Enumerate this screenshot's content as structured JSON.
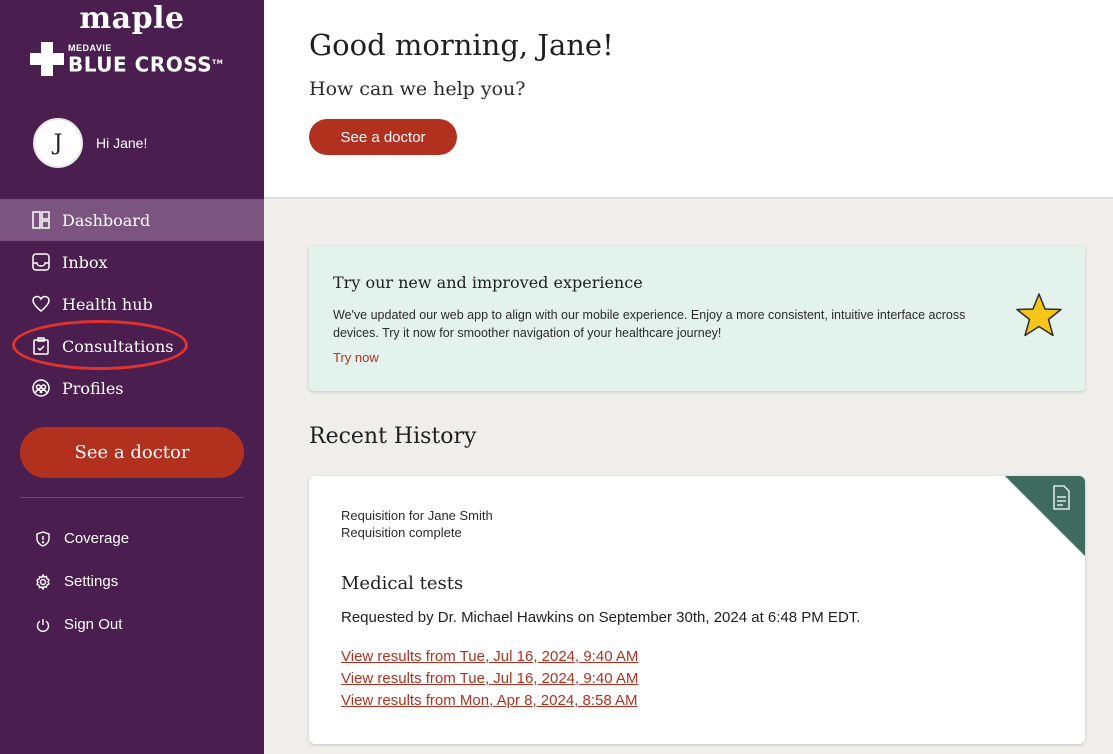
{
  "brand": {
    "maple": "maple",
    "medavie": "MEDAVIE",
    "bluecross": "BLUE CROSS",
    "trademark": "TM"
  },
  "user": {
    "initial": "J",
    "greeting": "Hi Jane!"
  },
  "nav": {
    "items": [
      {
        "label": "Dashboard",
        "icon": "dashboard-icon",
        "active": true
      },
      {
        "label": "Inbox",
        "icon": "inbox-icon"
      },
      {
        "label": "Health hub",
        "icon": "heart-icon"
      },
      {
        "label": "Consultations",
        "icon": "clipboard-icon"
      },
      {
        "label": "Profiles",
        "icon": "profiles-icon"
      }
    ]
  },
  "sidebar_cta": "See a doctor",
  "subnav": {
    "items": [
      {
        "label": "Coverage",
        "icon": "shield-icon"
      },
      {
        "label": "Settings",
        "icon": "gear-icon"
      },
      {
        "label": "Sign Out",
        "icon": "power-icon"
      }
    ]
  },
  "greeting": {
    "title": "Good morning, Jane!",
    "subtitle": "How can we help you?",
    "cta": "See a doctor"
  },
  "promo": {
    "title": "Try our new and improved experience",
    "body": "We've updated our web app to align with our mobile experience. Enjoy a more consistent, intuitive interface across devices. Try it now for smoother navigation of your healthcare journey!",
    "link": "Try now"
  },
  "history": {
    "title": "Recent History",
    "card": {
      "meta_line1": "Requisition for Jane Smith",
      "meta_line2": "Requisition complete",
      "heading": "Medical tests",
      "requested": "Requested by Dr. Michael Hawkins on September 30th, 2024 at 6:48 PM EDT.",
      "links": [
        "View results from Tue, Jul 16, 2024, 9:40 AM",
        "View results from Tue, Jul 16, 2024, 9:40 AM",
        "View results from Mon, Apr 8, 2024, 8:58 AM"
      ]
    }
  },
  "colors": {
    "sidebar_bg": "#4a1f4f",
    "active_nav_bg": "#7b5580",
    "accent": "#b2311e",
    "promo_bg": "#e3f2ec",
    "corner_badge": "#3e6b5e",
    "annotation": "#e3322d"
  }
}
